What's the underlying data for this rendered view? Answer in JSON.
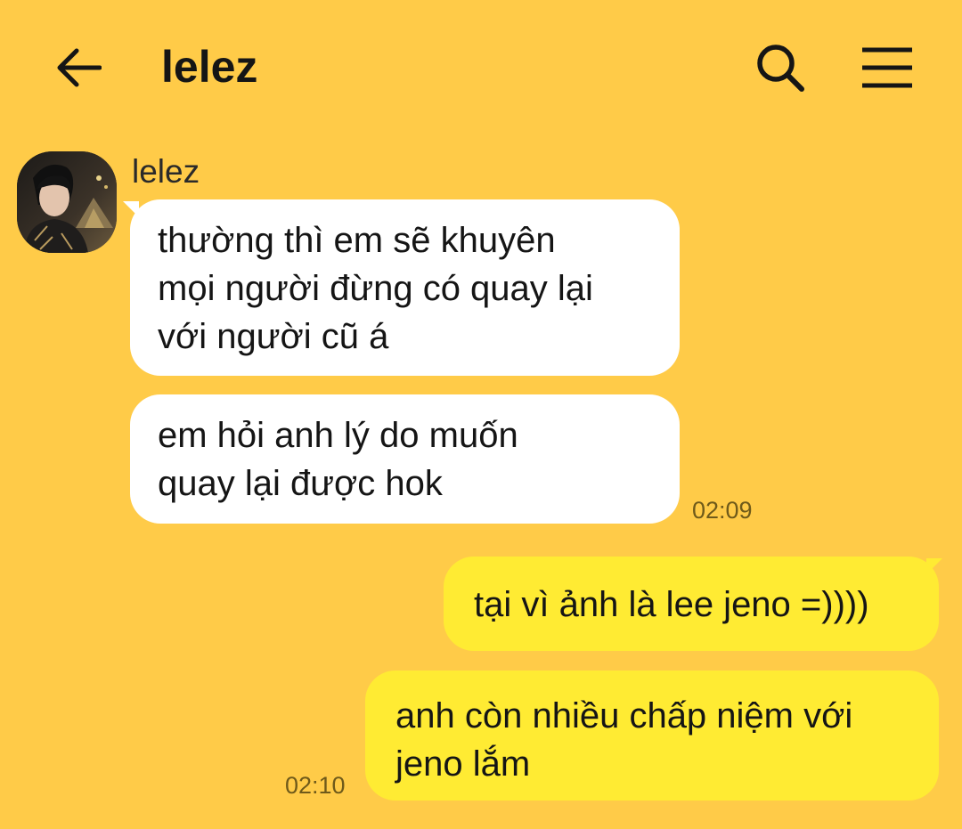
{
  "header": {
    "back_icon": "arrow-left-icon",
    "title": "lelez",
    "search_icon": "search-icon",
    "menu_icon": "hamburger-menu-icon"
  },
  "colors": {
    "background": "#FFCB48",
    "incoming_bubble": "#FFFFFF",
    "outgoing_bubble": "#FFEB33"
  },
  "messages": {
    "sender_name": "lelez",
    "incoming": [
      {
        "lines": [
          "thường thì em sẽ khuyên",
          "mọi người đừng có quay lại",
          "với người cũ á"
        ]
      },
      {
        "lines": [
          "em hỏi anh lý do muốn",
          "quay lại được hok"
        ],
        "time": "02:09"
      }
    ],
    "outgoing": [
      {
        "lines": [
          "tại vì ảnh là lee jeno =))))"
        ]
      },
      {
        "lines": [
          "anh còn nhiều chấp niệm với",
          "jeno lắm"
        ],
        "time": "02:10"
      }
    ]
  }
}
